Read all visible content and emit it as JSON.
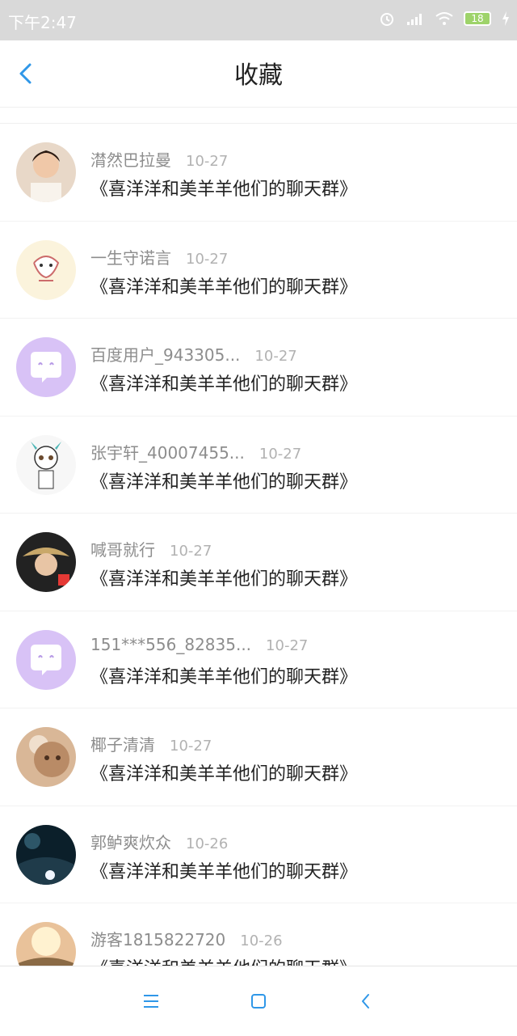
{
  "status": {
    "time": "下午2:47",
    "battery": "18"
  },
  "header": {
    "title": "收藏"
  },
  "items": [
    {
      "name": "潸然巴拉曼",
      "date": "10-27",
      "topic": "《喜洋洋和美羊羊他们的聊天群》"
    },
    {
      "name": "一生守诺言",
      "date": "10-27",
      "topic": "《喜洋洋和美羊羊他们的聊天群》"
    },
    {
      "name": "百度用户_943305...",
      "date": "10-27",
      "topic": "《喜洋洋和美羊羊他们的聊天群》"
    },
    {
      "name": "张宇轩_40007455...",
      "date": "10-27",
      "topic": "《喜洋洋和美羊羊他们的聊天群》"
    },
    {
      "name": "喊哥就行",
      "date": "10-27",
      "topic": "《喜洋洋和美羊羊他们的聊天群》"
    },
    {
      "name": "151***556_82835...",
      "date": "10-27",
      "topic": "《喜洋洋和美羊羊他们的聊天群》"
    },
    {
      "name": "椰子清清",
      "date": "10-27",
      "topic": "《喜洋洋和美羊羊他们的聊天群》"
    },
    {
      "name": "郭鲈爽炊众",
      "date": "10-26",
      "topic": "《喜洋洋和美羊羊他们的聊天群》"
    },
    {
      "name": "游客1815822720",
      "date": "10-26",
      "topic": "《喜洋洋和美羊羊他们的聊天群》"
    }
  ],
  "colors": {
    "accent": "#2f97e8",
    "default_avatar": "#d8c2f6"
  },
  "icons": {
    "back": "back-arrow-icon",
    "menu": "menu-icon",
    "home": "home-icon",
    "nav_back": "nav-back-icon"
  }
}
